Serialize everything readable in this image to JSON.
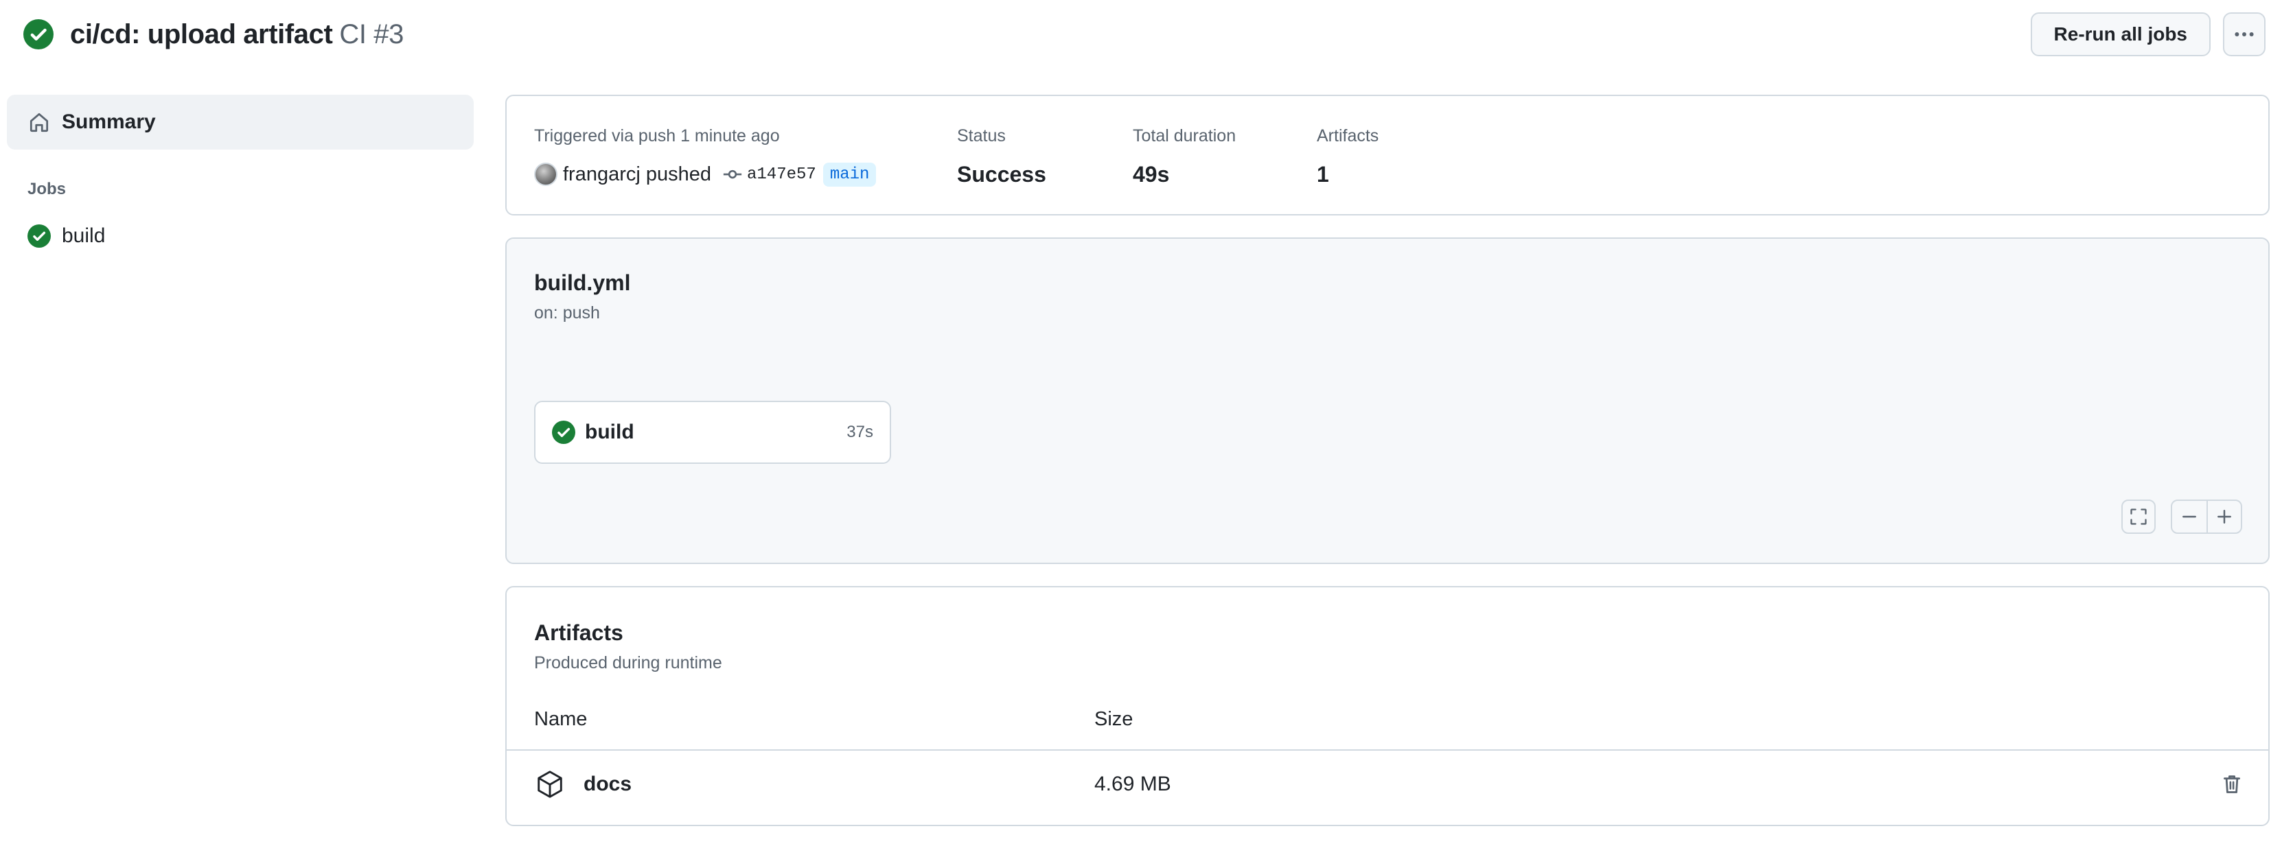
{
  "header": {
    "title": "ci/cd: upload artifact",
    "run_name": "CI #3",
    "rerun_label": "Re-run all jobs",
    "status": "success"
  },
  "sidebar": {
    "summary_label": "Summary",
    "jobs_heading": "Jobs",
    "jobs": [
      {
        "label": "build",
        "status": "success"
      }
    ]
  },
  "trigger": {
    "label": "Triggered via push 1 minute ago",
    "actor": "frangarcj",
    "action": "pushed",
    "commit": "a147e57",
    "branch": "main",
    "status_label": "Status",
    "status_value": "Success",
    "duration_label": "Total duration",
    "duration_value": "49s",
    "artifacts_label": "Artifacts",
    "artifacts_value": "1"
  },
  "workflow": {
    "file": "build.yml",
    "trigger": "on: push",
    "jobs": [
      {
        "name": "build",
        "duration": "37s",
        "status": "success"
      }
    ]
  },
  "artifacts": {
    "title": "Artifacts",
    "subtitle": "Produced during runtime",
    "columns": {
      "name": "Name",
      "size": "Size"
    },
    "rows": [
      {
        "name": "docs",
        "size": "4.69 MB"
      }
    ]
  },
  "colors": {
    "success": "#1a7f37",
    "border": "#d1d9e0",
    "muted_text": "#59636e",
    "branch_bg": "#ddf4ff",
    "branch_fg": "#0969da"
  },
  "icons": {
    "status": "check-circle-fill-icon",
    "summary": "home-icon",
    "commit": "git-commit-icon",
    "artifact": "package-icon",
    "delete": "trash-icon",
    "fullscreen": "screen-full-icon",
    "zoom_out": "dash-icon",
    "zoom_in": "plus-icon",
    "more": "kebab-horizontal-icon"
  }
}
